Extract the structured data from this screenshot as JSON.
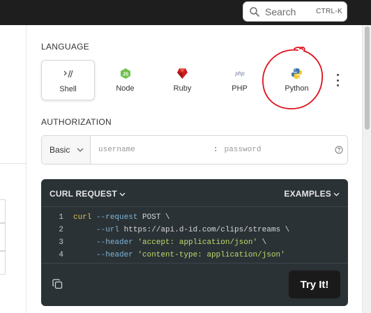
{
  "search": {
    "label": "Search",
    "shortcut": "CTRL-K"
  },
  "language": {
    "heading": "LANGUAGE",
    "items": [
      {
        "label": "Shell",
        "icon": "shell-icon",
        "selected": true
      },
      {
        "label": "Node",
        "icon": "node-icon",
        "selected": false
      },
      {
        "label": "Ruby",
        "icon": "ruby-icon",
        "selected": false
      },
      {
        "label": "PHP",
        "icon": "php-icon",
        "selected": false
      },
      {
        "label": "Python",
        "icon": "python-icon",
        "selected": false
      }
    ],
    "php_logo_text": "php"
  },
  "authorization": {
    "heading": "AUTHORIZATION",
    "scheme": "Basic",
    "username_placeholder": "username",
    "separator": ":",
    "password_placeholder": "password"
  },
  "request": {
    "title": "CURL REQUEST",
    "examples_label": "EXAMPLES",
    "lines": [
      {
        "n": "1",
        "parts": [
          [
            "cmd",
            "curl"
          ],
          [
            "plain",
            " "
          ],
          [
            "flag",
            "--request"
          ],
          [
            "plain",
            " POST \\"
          ]
        ]
      },
      {
        "n": "2",
        "parts": [
          [
            "plain",
            "     "
          ],
          [
            "flag",
            "--url"
          ],
          [
            "plain",
            " https://api.d-id.com/clips/streams \\"
          ]
        ]
      },
      {
        "n": "3",
        "parts": [
          [
            "plain",
            "     "
          ],
          [
            "flag",
            "--header"
          ],
          [
            "plain",
            " "
          ],
          [
            "str",
            "'accept: application/json'"
          ],
          [
            "plain",
            " \\"
          ]
        ]
      },
      {
        "n": "4",
        "parts": [
          [
            "plain",
            "     "
          ],
          [
            "flag",
            "--header"
          ],
          [
            "plain",
            " "
          ],
          [
            "str",
            "'content-type: application/json'"
          ]
        ]
      }
    ],
    "try_label": "Try It!"
  },
  "colors": {
    "topbar": "#1e1e1e",
    "code_bg": "#2a3236",
    "annotation": "#e0101a"
  }
}
